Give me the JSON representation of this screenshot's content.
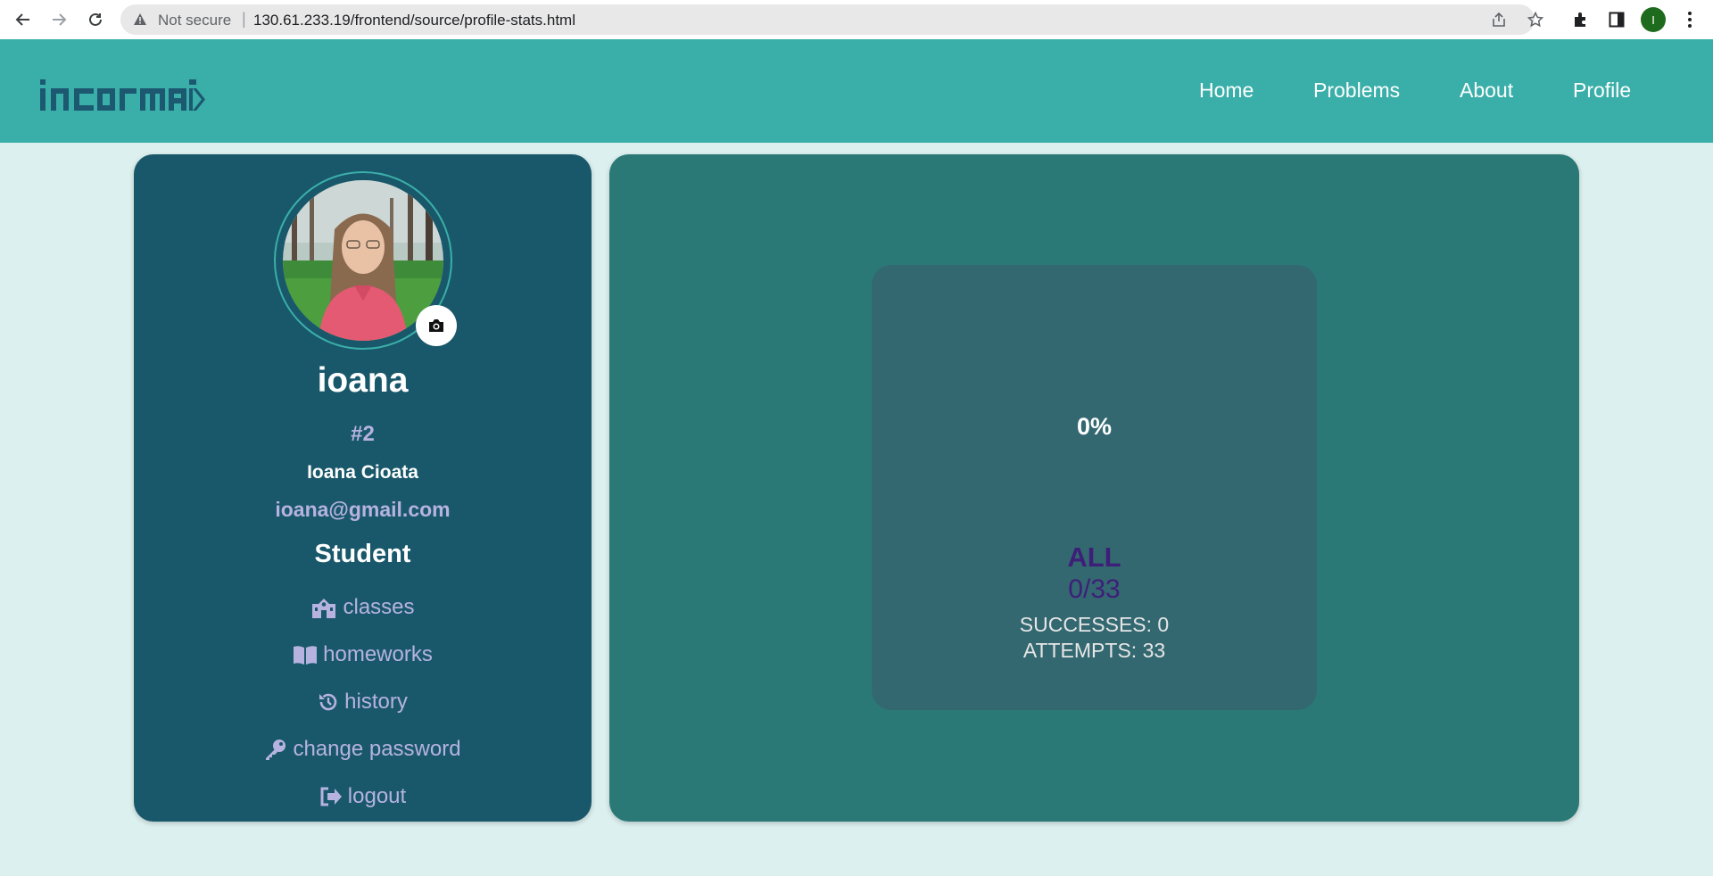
{
  "browser": {
    "security_label": "Not secure",
    "separator": "|",
    "url": "130.61.233.19/frontend/source/profile-stats.html",
    "profile_initial": "I"
  },
  "site": {
    "logo_text": "infomatix",
    "menu": [
      "Home",
      "Problems",
      "About",
      "Profile"
    ]
  },
  "profile": {
    "username": "ioana",
    "rank": "#2",
    "full_name": "Ioana Cioata",
    "email": "ioana@gmail.com",
    "role": "Student",
    "links": [
      {
        "label": "classes",
        "icon": "school-icon"
      },
      {
        "label": "homeworks",
        "icon": "book-icon"
      },
      {
        "label": "history",
        "icon": "history-icon"
      },
      {
        "label": "change password",
        "icon": "key-icon"
      },
      {
        "label": "logout",
        "icon": "logout-icon"
      }
    ]
  },
  "stats": {
    "percent": "0%",
    "category": "ALL",
    "ratio": "0/33",
    "successes": "SUCCESSES: 0",
    "attempts": "ATTEMPTS: 33"
  },
  "colors": {
    "header": "#3aafa9",
    "profile_card": "#19586a",
    "stats_card": "#2b7977",
    "stat_box": "#336871",
    "accent_lilac": "#b6b3e0",
    "accent_purple": "#3e1f78"
  }
}
